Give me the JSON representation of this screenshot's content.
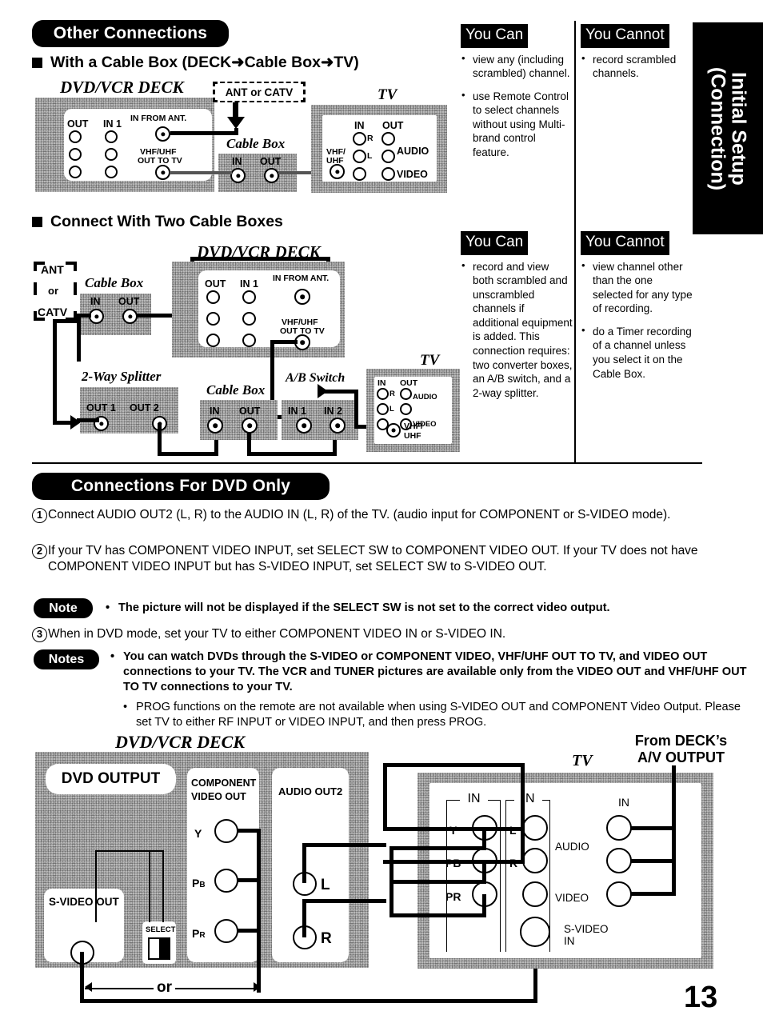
{
  "page": {
    "number": "13",
    "side_tab_line1": "Initial Setup",
    "side_tab_line2": "(Connection)"
  },
  "sections": {
    "other_connections": {
      "header": "Other Connections",
      "sub1": "With a Cable Box (DECK➜Cable Box➜TV)",
      "sub2": "Connect With Two Cable Boxes"
    },
    "dvd_only": {
      "header": "Connections For DVD Only"
    }
  },
  "can_cannot": [
    {
      "can_title": "You Can",
      "can_items": [
        "view any (including scrambled) channel.",
        "use Remote Control to select channels without using Multi-brand control feature."
      ],
      "cannot_title": "You Cannot",
      "cannot_items": [
        "record scrambled channels."
      ]
    },
    {
      "can_title": "You Can",
      "can_items": [
        "record and view both scrambled and unscrambled channels if additional equipment is added. This connection requires: two converter boxes, an A/B switch, and a 2-way splitter."
      ],
      "cannot_title": "You Cannot",
      "cannot_items": [
        "view channel other than the one selected for any type of recording.",
        "do a Timer recording of a channel unless you select it on the Cable Box."
      ]
    }
  ],
  "diagram1": {
    "deck_title": "DVD/VCR DECK",
    "tv_title": "TV",
    "cable_box_title": "Cable Box",
    "ant_catv": "ANT or CATV",
    "deck_labels": {
      "out": "OUT",
      "in1": "IN 1",
      "in_from_ant": "IN FROM ANT.",
      "vhf_out": "VHF/UHF\nOUT TO TV"
    },
    "deck_label_vhf_l1": "VHF/UHF",
    "deck_label_vhf_l2": "OUT TO TV",
    "cable_box_in": "IN",
    "cable_box_out": "OUT",
    "tv_labels": {
      "in": "IN",
      "out": "OUT",
      "r": "R",
      "l": "L",
      "audio": "AUDIO",
      "video": "VIDEO",
      "vhf_l1": "VHF/",
      "vhf_l2": "UHF"
    }
  },
  "diagram2": {
    "deck_title": "DVD/VCR DECK",
    "tv_title": "TV",
    "cable_box_title": "Cable Box",
    "splitter_title": "2-Way Splitter",
    "ab_switch_title": "A/B Switch",
    "ant": "ANT",
    "or": "or",
    "catv": "CATV",
    "deck_labels": {
      "out": "OUT",
      "in1": "IN 1",
      "in_from_ant": "IN FROM ANT."
    },
    "deck_label_vhf_l1": "VHF/UHF",
    "deck_label_vhf_l2": "OUT TO TV",
    "cable_in": "IN",
    "cable_out": "OUT",
    "out1": "OUT 1",
    "out2": "OUT 2",
    "in1": "IN 1",
    "in2": "IN 2",
    "tv_labels": {
      "in": "IN",
      "out": "OUT",
      "r": "R",
      "l": "L",
      "audio": "AUDIO",
      "video": "VIDEO",
      "vhf_l1": "VHF/",
      "vhf_l2": "UHF"
    }
  },
  "dvd_only_text": {
    "item1_num": "1",
    "item1": "Connect AUDIO OUT2 (L, R) to the AUDIO IN (L, R) of the TV. (audio input for COMPONENT or S-VIDEO mode).",
    "item2_num": "2",
    "item2": "If your TV has COMPONENT VIDEO INPUT, set SELECT SW to COMPONENT VIDEO OUT. If your TV does not have COMPONENT VIDEO INPUT but has S-VIDEO INPUT, set SELECT SW to S-VIDEO OUT.",
    "note_label": "Note",
    "note_text": "The picture will not be displayed if the SELECT SW is not set to the correct video output.",
    "item3_num": "3",
    "item3": "When in DVD mode, set your TV to either COMPONENT VIDEO IN or S-VIDEO IN.",
    "notes_label": "Notes",
    "notes_text1": "You can watch DVDs through the S-VIDEO or COMPONENT VIDEO, VHF/UHF OUT TO TV, and VIDEO OUT connections to your TV. The VCR and TUNER pictures are available only from the VIDEO OUT and VHF/UHF OUT TO TV connections to your TV.",
    "notes_text2": "PROG functions on the remote are not available when using S-VIDEO OUT and COMPONENT Video Output. Please set TV to either RF INPUT or VIDEO INPUT, and then press PROG."
  },
  "diagram3": {
    "deck_title": "DVD/VCR DECK",
    "tv_title": "TV",
    "dvd_output": "DVD OUTPUT",
    "svideo_out": "S-VIDEO OUT",
    "select": "SELECT",
    "component_l1": "COMPONENT",
    "component_l2": "VIDEO OUT",
    "audio_out2": "AUDIO OUT2",
    "y": "Y",
    "pb_p": "P",
    "pb_sub": "B",
    "pr_p": "P",
    "pr_sub": "R",
    "l": "L",
    "r": "R",
    "or": "or",
    "from_deck_l1": "From DECK’s",
    "from_deck_l2": "A/V OUTPUT",
    "tv_in": "IN",
    "tv_y": "Y",
    "tv_pb": "PB",
    "tv_pr": "PR",
    "tv_l": "L",
    "tv_r": "R",
    "tv_audio": "AUDIO",
    "tv_video": "VIDEO",
    "tv_svideo_l1": "S-VIDEO",
    "tv_svideo_l2": "IN"
  }
}
